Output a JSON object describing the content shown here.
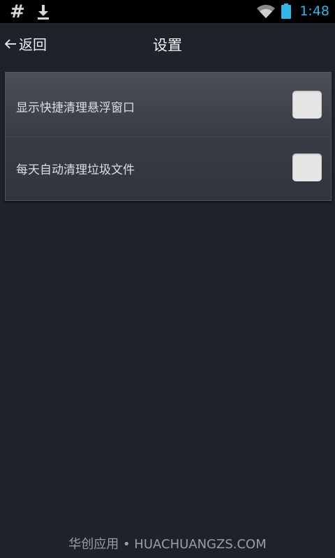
{
  "status_bar": {
    "left_icons": [
      "hash-icon",
      "download-icon"
    ],
    "right_icons": [
      "wifi-icon",
      "battery-icon"
    ],
    "time": "1:48",
    "hash_glyph": "#",
    "accent_color": "#33b5e5"
  },
  "header": {
    "back_label": "返回",
    "title": "设置"
  },
  "settings": {
    "items": [
      {
        "label": "显示快捷清理悬浮窗口",
        "checked": false
      },
      {
        "label": "每天自动清理垃圾文件",
        "checked": false
      }
    ]
  },
  "watermark": {
    "text": "华创应用 • HUACHUANGZS.COM"
  }
}
